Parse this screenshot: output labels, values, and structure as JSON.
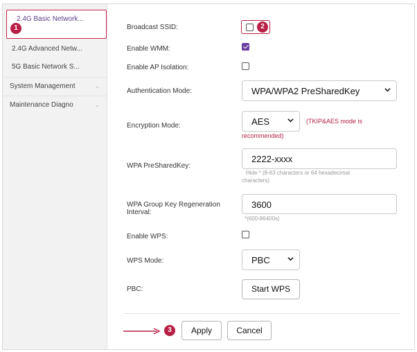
{
  "sidebar": {
    "items": [
      {
        "label": "2.4G Basic Network..."
      },
      {
        "label": "2.4G Advanced Netw..."
      },
      {
        "label": "5G Basic Network S..."
      },
      {
        "label": "System Management"
      },
      {
        "label": "Maintenance Diagno"
      }
    ]
  },
  "badges": {
    "one": "1",
    "two": "2",
    "three": "3"
  },
  "form": {
    "broadcast_ssid": {
      "label": "Broadcast SSID:",
      "checked": false
    },
    "enable_wmm": {
      "label": "Enable WMM:",
      "checked": true
    },
    "enable_ap_isolation": {
      "label": "Enable AP Isolation:",
      "checked": false
    },
    "authentication_mode": {
      "label": "Authentication Mode:",
      "value": "WPA/WPA2 PreSharedKey"
    },
    "encryption_mode": {
      "label": "Encryption Mode:",
      "value": "AES",
      "note_line1": "(TKIP&AES mode is",
      "note_line2": "recommended)"
    },
    "wpa_presharedkey": {
      "label": "WPA PreSharedKey:",
      "value": "2222-xxxx",
      "hint_line1": "Hide * (8-63 characters or 64 hexadecimal",
      "hint_line2": "characters)"
    },
    "group_key_regen": {
      "label_line1": "WPA Group Key Regeneration",
      "label_line2": "Interval:",
      "value": "3600",
      "hint": "*(600-86400s)"
    },
    "enable_wps": {
      "label": "Enable WPS:",
      "checked": false
    },
    "wps_mode": {
      "label": "WPS Mode:",
      "value": "PBC"
    },
    "pbc": {
      "label": "PBC:",
      "button": "Start WPS"
    }
  },
  "actions": {
    "apply": "Apply",
    "cancel": "Cancel"
  },
  "colors": {
    "accent": "#b81f45",
    "checkbox_checked": "#6b3fa0",
    "active_text": "#5c3c86"
  }
}
